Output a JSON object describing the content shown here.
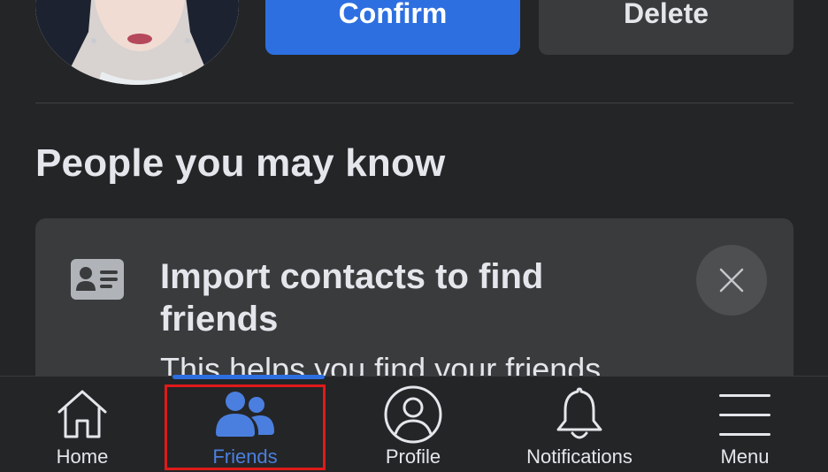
{
  "request": {
    "confirm_label": "Confirm",
    "delete_label": "Delete"
  },
  "section": {
    "title": "People you may know"
  },
  "import_card": {
    "icon": "contact-card-icon",
    "title": "Import contacts to find friends",
    "subtitle": "This helps you find your friends"
  },
  "tabbar": {
    "tabs": [
      {
        "label": "Home",
        "icon": "home-icon"
      },
      {
        "label": "Friends",
        "icon": "friends-icon",
        "active": true
      },
      {
        "label": "Profile",
        "icon": "profile-icon"
      },
      {
        "label": "Notifications",
        "icon": "bell-icon"
      },
      {
        "label": "Menu",
        "icon": "menu-icon"
      }
    ]
  },
  "colors": {
    "background": "#242526",
    "card": "#3a3b3c",
    "accent": "#2d6fe0",
    "highlight": "#e01a1a"
  }
}
